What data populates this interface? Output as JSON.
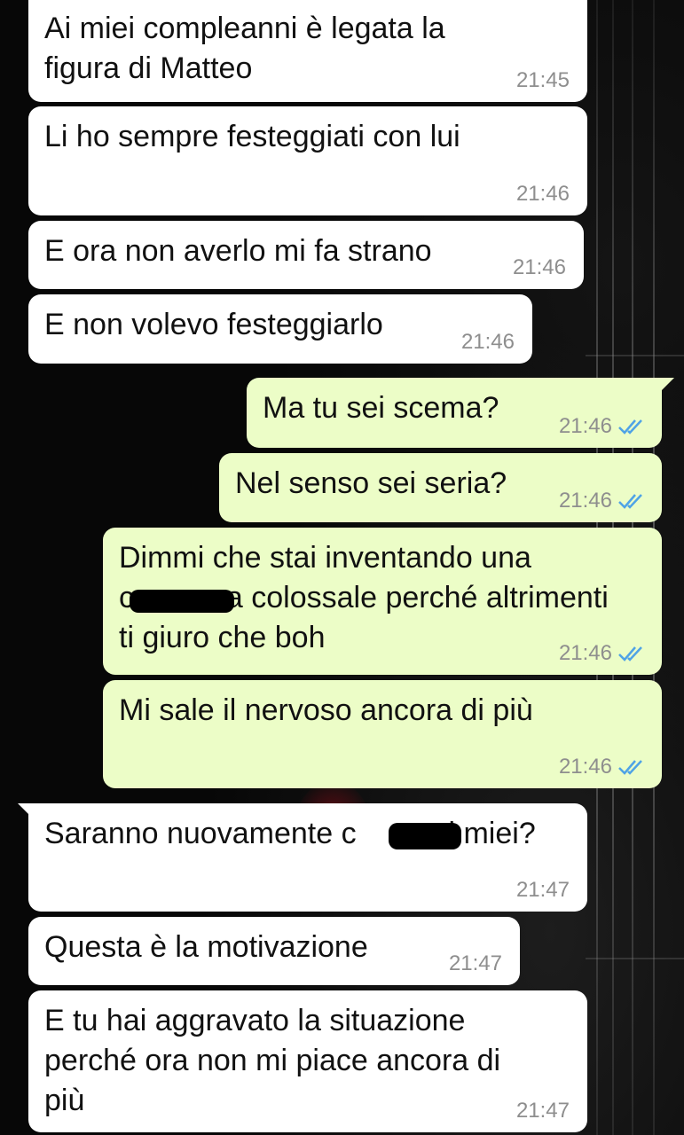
{
  "theme": {
    "incoming_bubble_color": "#ffffff",
    "outgoing_bubble_color": "#ecfdc7",
    "tick_color": "#4fa3e6",
    "time_color": "#8e8e8e"
  },
  "messages": [
    {
      "direction": "in",
      "text": "Ai miei compleanni è legata la\nfigura di Matteo",
      "time": "21:45"
    },
    {
      "direction": "in",
      "text": "Li ho sempre festeggiati con lui",
      "time": "21:46"
    },
    {
      "direction": "in",
      "text": "E ora non averlo mi fa strano",
      "time": "21:46"
    },
    {
      "direction": "in",
      "text": "E non volevo festeggiarlo",
      "time": "21:46"
    },
    {
      "direction": "out",
      "text": "Ma tu sei scema?",
      "time": "21:46",
      "status_icon": "double-check-read-icon"
    },
    {
      "direction": "out",
      "text": "Nel senso sei seria?",
      "time": "21:46",
      "status_icon": "double-check-read-icon"
    },
    {
      "direction": "out",
      "text": "Dimmi che stai inventando una\nc           a colossale perché altrimenti\nti giuro che boh",
      "time": "21:46",
      "status_icon": "double-check-read-icon",
      "has_redaction": true
    },
    {
      "direction": "out",
      "text": "Mi sale il nervoso ancora di più",
      "time": "21:46",
      "status_icon": "double-check-read-icon"
    },
    {
      "direction": "in",
      "text": "Saranno nuovamente c           i miei?",
      "time": "21:47",
      "has_redaction": true
    },
    {
      "direction": "in",
      "text": "Questa è la motivazione",
      "time": "21:47"
    },
    {
      "direction": "in",
      "text": "E tu hai aggravato la situazione\nperché ora non mi piace ancora di\npiù",
      "time": "21:47"
    }
  ]
}
